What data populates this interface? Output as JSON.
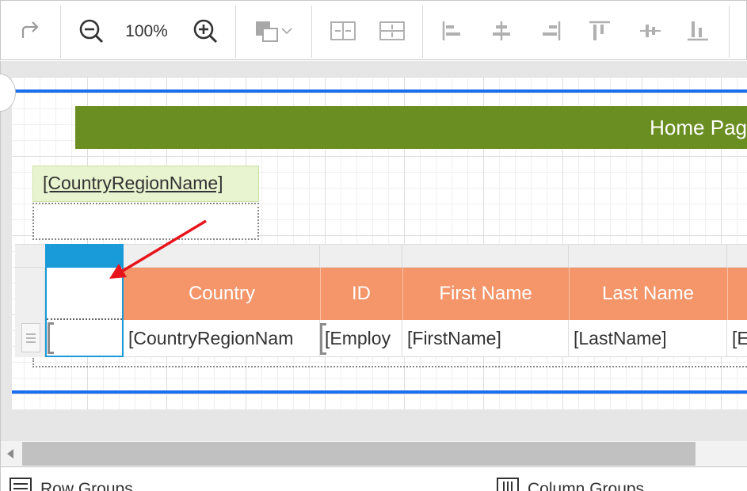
{
  "toolbar": {
    "zoom_level": "100%",
    "icons": [
      "redo-icon",
      "zoom-out-icon",
      "zoom-in-icon",
      "background-color-icon",
      "dropdown-chevron-icon",
      "distribute-horizontal-icon",
      "distribute-vertical-icon",
      "align-left-icon",
      "align-center-icon",
      "align-right-icon",
      "align-top-icon",
      "align-middle-icon",
      "align-bottom-icon"
    ]
  },
  "report": {
    "page_header_title": "Home Pag",
    "group_header_field": "[CountryRegionName]"
  },
  "tablix": {
    "headers": [
      "Country",
      "ID",
      "First Name",
      "Last Name",
      ""
    ],
    "cells": [
      "[CountryRegionNam",
      "[Employ",
      "[FirstName]",
      "[LastName]",
      "[E"
    ]
  },
  "groups_panel": {
    "row_groups_label": "Row Groups",
    "column_groups_label": "Column Groups"
  },
  "colors": {
    "page_header_bg": "#6b8e23",
    "group_header_bg": "#e8f4cf",
    "table_header_bg": "#f4956a",
    "selection_blue": "#199ad9",
    "band_line_blue": "#1a6ef0",
    "annotation_arrow": "#e8141c"
  }
}
